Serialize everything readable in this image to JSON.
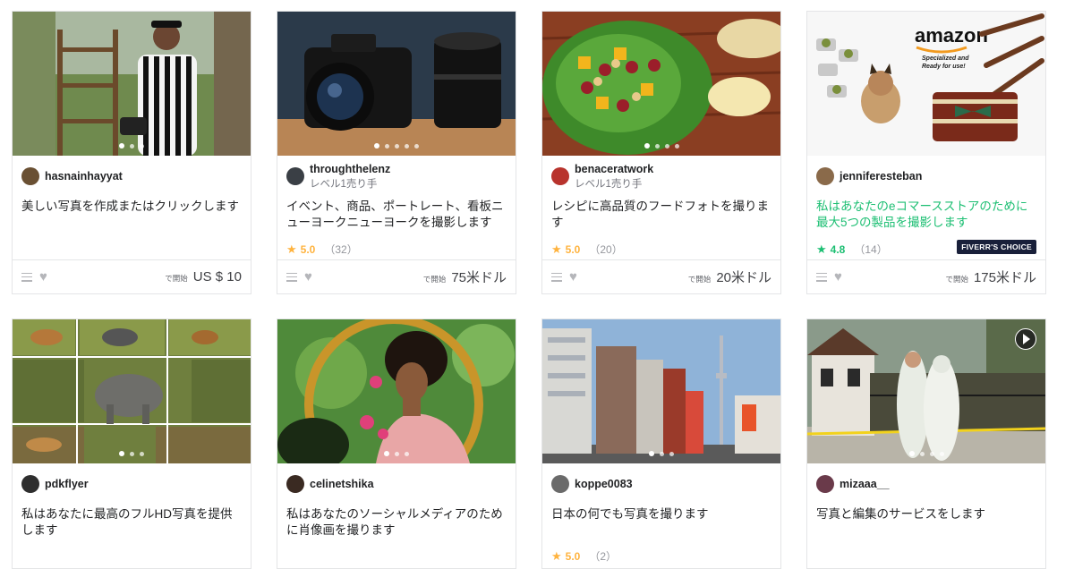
{
  "gigs": [
    {
      "seller": "hasnainhayyat",
      "level": "",
      "title": "美しい写真を作成またはクリックします",
      "rating": "",
      "reviews": "",
      "price_label": "で開始",
      "price": "US $ 10"
    },
    {
      "seller": "throughthelenz",
      "level": "レベル1売り手",
      "title": "イベント、商品、ポートレート、看板ニューヨークニューヨークを撮影します",
      "rating": "5.0",
      "reviews": "（32）",
      "price_label": "で開始",
      "price": "75米ドル"
    },
    {
      "seller": "benaceratwork",
      "level": "レベル1売り手",
      "title": "レシピに高品質のフードフォトを撮ります",
      "rating": "5.0",
      "reviews": "（20）",
      "price_label": "で開始",
      "price": "20米ドル"
    },
    {
      "seller": "jenniferesteban",
      "level": "",
      "title": "私はあなたのeコマースストアのために最大5つの製品を撮影します",
      "rating": "4.8",
      "reviews": "（14）",
      "badge": "FIVERR'S CHOICE",
      "price_label": "で開始",
      "price": "175米ドル",
      "thumb_text": {
        "brand": "amazon",
        "tagline1": "Specialized and",
        "tagline2": "Ready for use!"
      }
    },
    {
      "seller": "pdkflyer",
      "title": "私はあなたに最高のフルHD写真を提供します"
    },
    {
      "seller": "celinetshika",
      "title": "私はあなたのソーシャルメディアのために肖像画を撮ります"
    },
    {
      "seller": "koppe0083",
      "title": "日本の何でも写真を撮ります",
      "rating": "5.0",
      "reviews": "（2）"
    },
    {
      "seller": "mizaaa__",
      "title": "写真と編集のサービスをします"
    }
  ],
  "colors": {
    "accent": "#1dbf73",
    "star": "#ffb33e",
    "badge_bg": "#19203a"
  },
  "icons": [
    "collection-menu-icon",
    "heart-icon",
    "star-icon",
    "play-icon"
  ]
}
